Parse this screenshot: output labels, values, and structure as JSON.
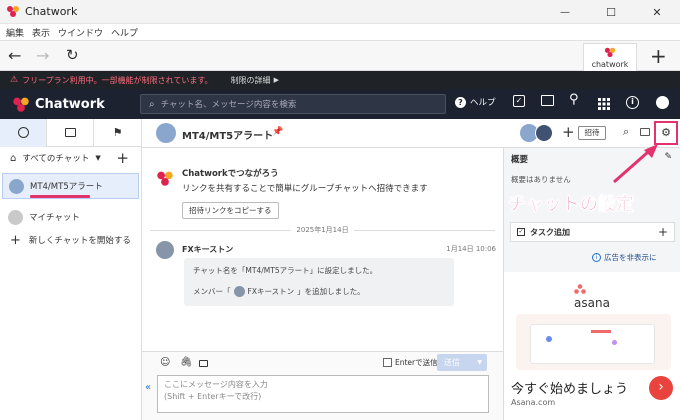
{
  "window": {
    "title": "Chatwork",
    "minimize": "—",
    "maximize": "☐",
    "close": "✕"
  },
  "menu": [
    "編集",
    "表示",
    "ウインドウ",
    "ヘルプ"
  ],
  "tab": {
    "label": "chatwork"
  },
  "notice": {
    "text": "フリープラン利用中。一部機能が制限されています。",
    "link": "制限の詳細"
  },
  "header": {
    "brand": "Chatwork",
    "search_placeholder": "チャット名、メッセージ内容を検索",
    "help": "ヘルプ"
  },
  "left": {
    "filter": "すべてのチャット",
    "rooms": [
      {
        "name": "MT4/MT5アラート"
      },
      {
        "name": "マイチャット"
      }
    ],
    "new_chat": "新しくチャットを開始する"
  },
  "room": {
    "title": "MT4/MT5アラート",
    "invite_label": "招待"
  },
  "welcome": {
    "title": "Chatworkでつながろう",
    "text": "リンクを共有することで簡単にグループチャットへ招待できます",
    "button": "招待リンクをコピーする"
  },
  "date_divider": "2025年1月14日",
  "message": {
    "author": "FXキーストン",
    "time": "1月14日 10:06",
    "line1": "チャット名を「MT4/MT5アラート」に設定しました。",
    "line2_prefix": "メンバー「",
    "line2_name": "FXキーストン",
    "line2_suffix": "」を追加しました。"
  },
  "composer": {
    "enter_label": "Enterで送信",
    "send_label": "送信",
    "placeholder_line1": "ここにメッセージ内容を入力",
    "placeholder_line2": "(Shift + Enterキーで改行)"
  },
  "summary": {
    "title": "概要",
    "empty": "概要はありません"
  },
  "task": {
    "label": "タスク追加"
  },
  "ad": {
    "hide_label": "広告を非表示に",
    "brand": "asana",
    "headline": "今すぐ始めましょう",
    "domain": "Asana.com"
  },
  "annotation": {
    "label": "チャットの設定"
  },
  "colors": {
    "accent": "#e3336c",
    "header": "#1c2230",
    "selected": "#e6eefb",
    "brand_red": "#e0224f"
  }
}
